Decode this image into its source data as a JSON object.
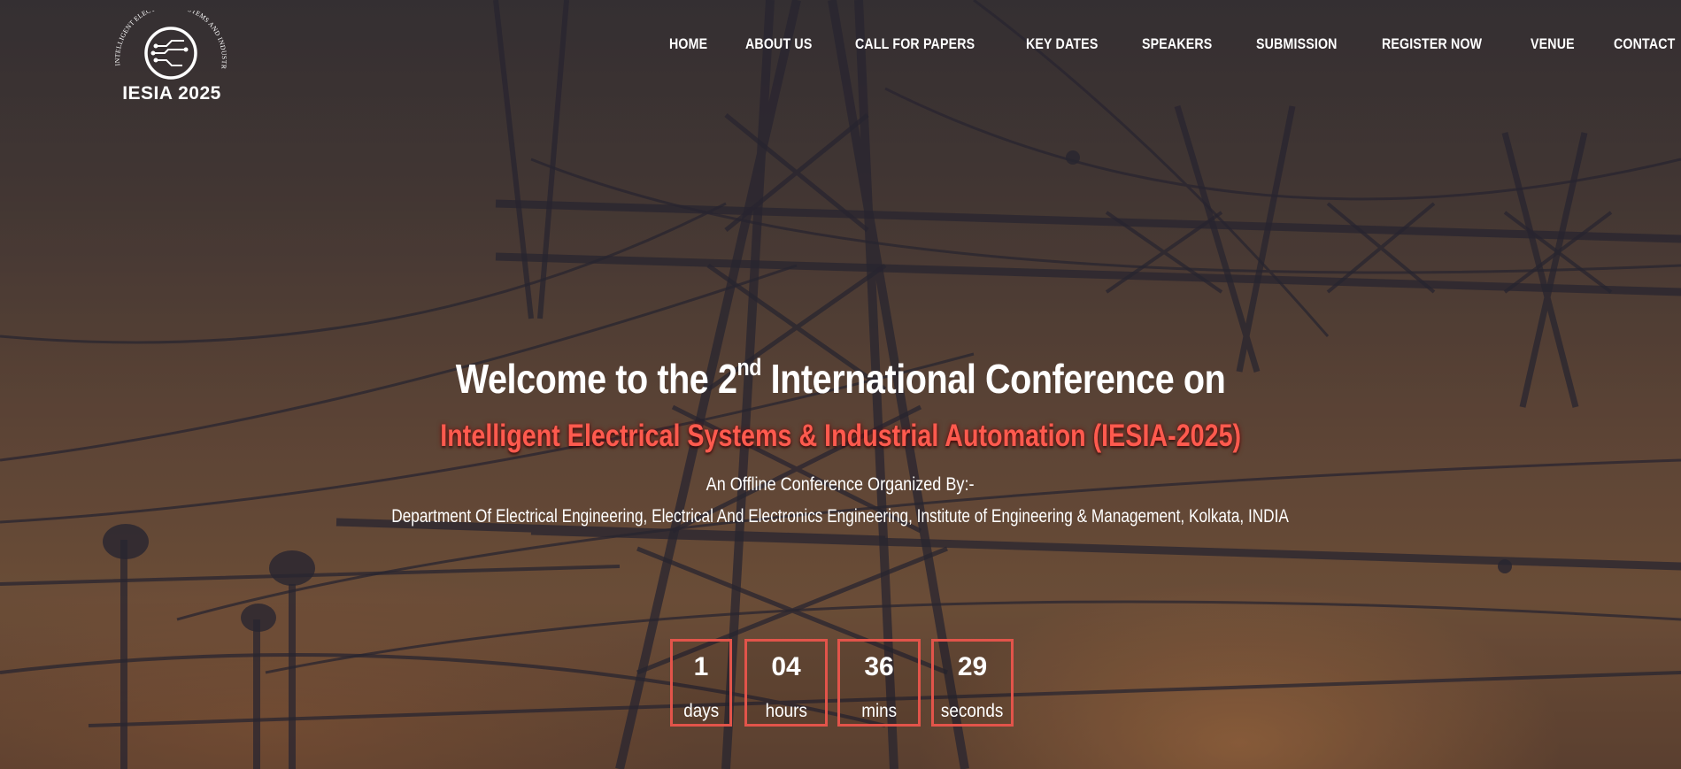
{
  "brand": {
    "logo_text": "IESIA 2025",
    "logo_arc_text": "INTELLIGENT ELECTRICAL SYSTEMS AND INDUSTRIAL AUTOMATION"
  },
  "nav": {
    "items": [
      {
        "label": "HOME"
      },
      {
        "label": "ABOUT US"
      },
      {
        "label": "CALL FOR PAPERS"
      },
      {
        "label": "KEY DATES"
      },
      {
        "label": "SPEAKERS"
      },
      {
        "label": "SUBMISSION"
      },
      {
        "label": "REGISTER NOW"
      },
      {
        "label": "VENUE"
      },
      {
        "label": "CONTACT"
      }
    ]
  },
  "hero": {
    "welcome_prefix": "Welcome to the 2",
    "welcome_sup": "nd",
    "welcome_suffix": " International Conference on",
    "conference_name": "Intelligent Electrical Systems & Industrial Automation (IESIA-2025)",
    "organized_by": "An Offline Conference Organized By:-",
    "department": "Department Of Electrical Engineering, Electrical And Electronics Engineering, Institute of Engineering & Management, Kolkata, INDIA"
  },
  "countdown": [
    {
      "value": "1",
      "unit": "days"
    },
    {
      "value": "04",
      "unit": "hours"
    },
    {
      "value": "36",
      "unit": "mins"
    },
    {
      "value": "29",
      "unit": "seconds"
    }
  ],
  "colors": {
    "accent": "#e2544a",
    "headline_red": "#ff5a4e",
    "text": "#ffffff"
  }
}
